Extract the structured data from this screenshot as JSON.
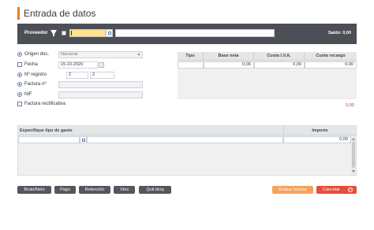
{
  "page": {
    "title": "Entrada de datos"
  },
  "proveedor_bar": {
    "label": "Proveedor",
    "code_value": "",
    "name_value": "",
    "saldo": "Saldo: 0,00",
    "icons": {
      "filter": "filter-icon",
      "lookup": "lookup-icon"
    }
  },
  "form": {
    "origen": {
      "label": "Origen doc.",
      "value": "Nacional"
    },
    "fecha": {
      "label": "Fecha",
      "value": "15-10-2020"
    },
    "registro": {
      "label": "Nº registro",
      "value1": "2",
      "value2": "2"
    },
    "factura": {
      "label": "Factura nº",
      "value": ""
    },
    "nif": {
      "label": "NIF",
      "value": ""
    },
    "rectificativa": {
      "label": "Factura rectificativa"
    }
  },
  "tax_table": {
    "columns": [
      "Tipo",
      "Base neta",
      "Cuota I.V.A.",
      "Cuota recargo"
    ],
    "row": [
      "",
      "0,00",
      "0,00",
      "0,00"
    ],
    "total": "0,00"
  },
  "expense_table": {
    "columns": [
      "Especifique tipo de gasto",
      "Importe"
    ],
    "row": {
      "tipo": "",
      "importe": "0,00"
    }
  },
  "buttons": {
    "bruto_neto": "Bruto/Neto",
    "pago": "Pago",
    "retencion": "Retención",
    "vtos": "Vtos",
    "quit_bloq": "Quit bloq",
    "grabar": "Grabar factura",
    "cancelar": "Cancelar"
  },
  "colors": {
    "accent": "#f07d1c",
    "header_bar": "#4d4f56",
    "cancel": "#e74c3c",
    "save": "#f5a25d",
    "total_red": "#c0392b"
  }
}
